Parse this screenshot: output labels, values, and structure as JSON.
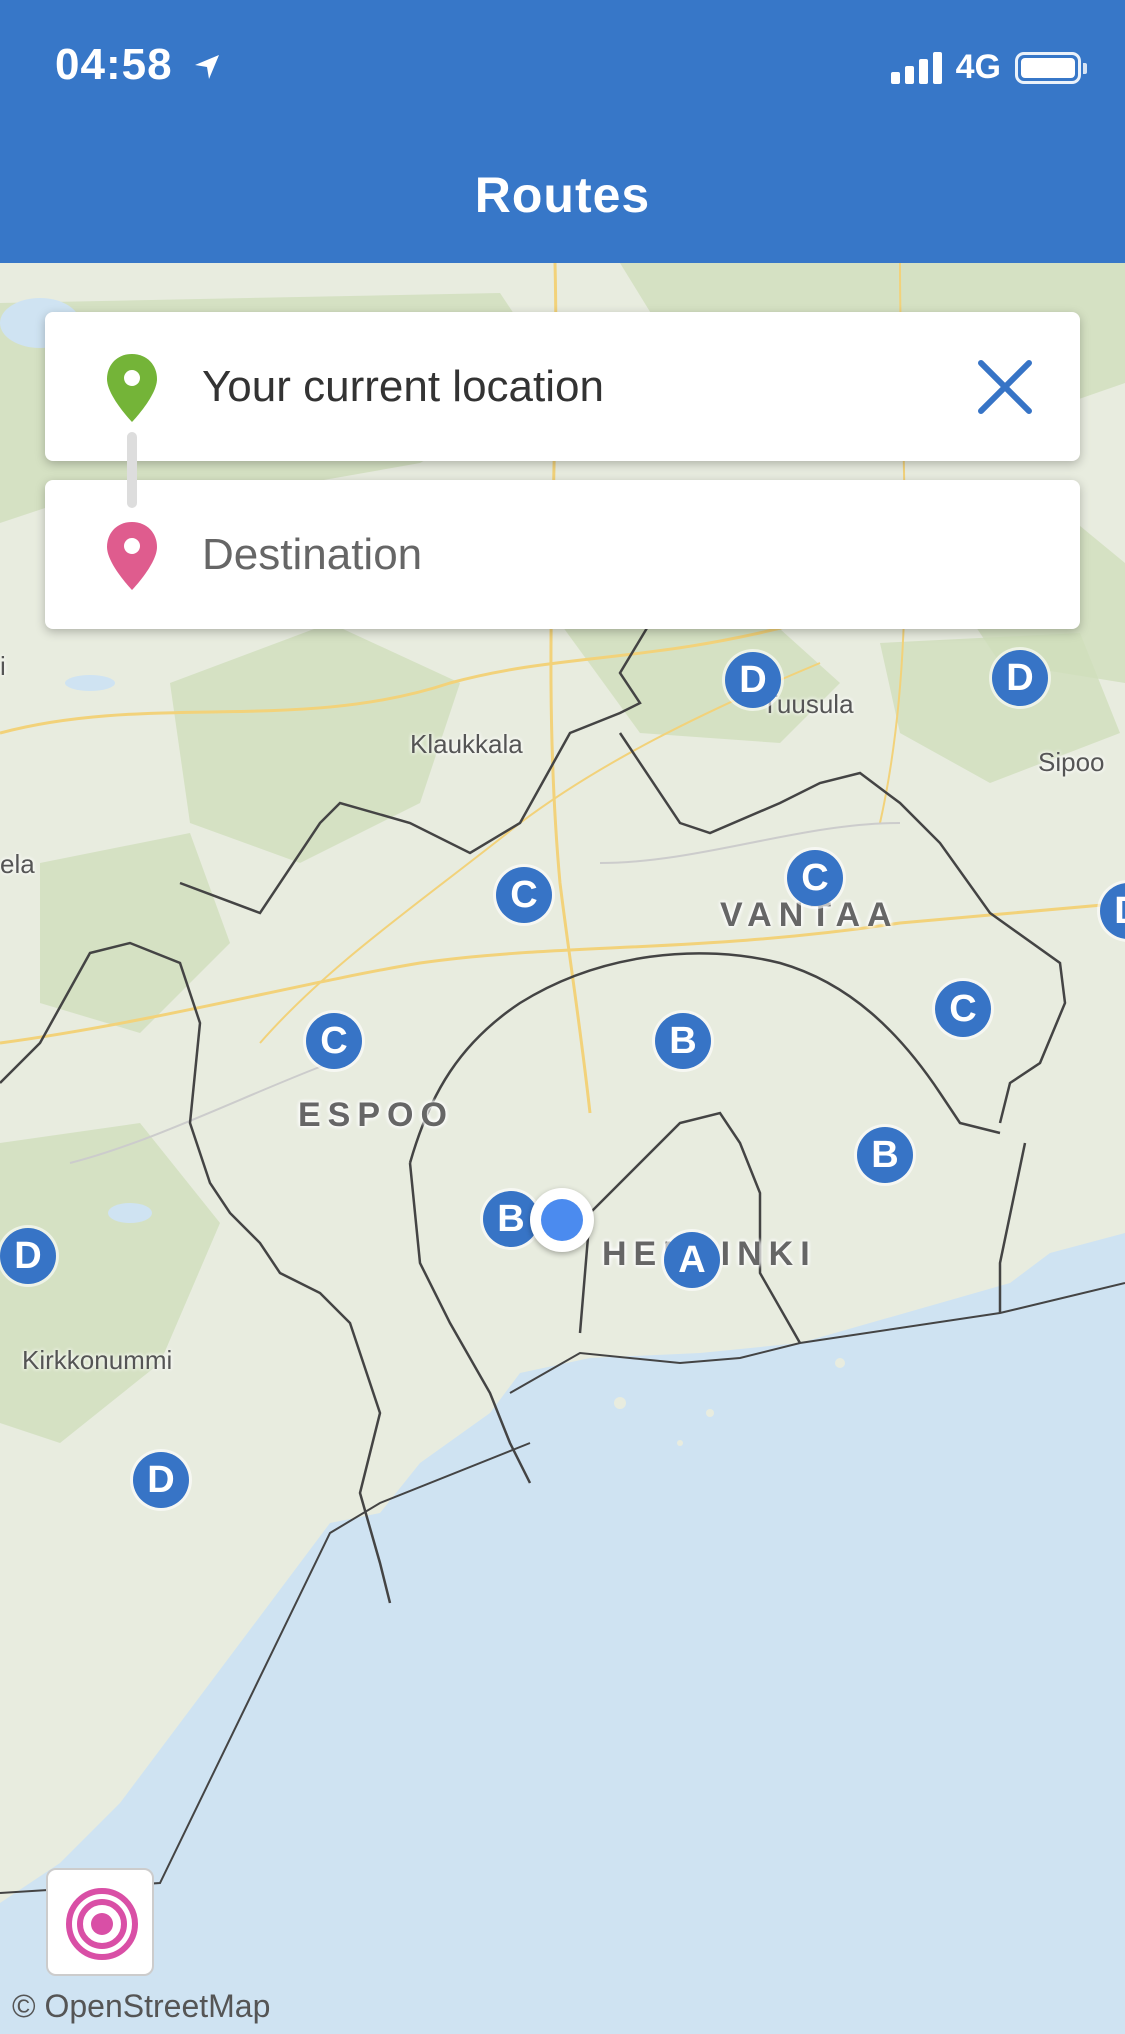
{
  "status_bar": {
    "time": "04:58",
    "network": "4G"
  },
  "header": {
    "title": "Routes"
  },
  "search": {
    "origin_value": "Your current location",
    "destination_placeholder": "Destination"
  },
  "map": {
    "places": [
      "Klaukkala",
      "Tuusula",
      "Sipoo",
      "Kirkkonummi",
      "ela",
      "i"
    ],
    "cities": [
      "VANTAA",
      "ESPOO",
      "HELSINKI"
    ],
    "zones": [
      "D",
      "D",
      "C",
      "C",
      "C",
      "C",
      "B",
      "B",
      "B",
      "A",
      "D",
      "D",
      "D"
    ],
    "attribution": "© OpenStreetMap",
    "colors": {
      "sea": "#cfe3f2",
      "land": "#e9ecdf",
      "forest": "#cddcb8",
      "zone_marker": "#3774c6",
      "user_location": "#4b8bef",
      "header": "#3777c8"
    }
  },
  "icons": {
    "origin": "green-pin-icon",
    "destination": "pink-pin-icon",
    "clear": "close-icon",
    "locate": "locate-target-icon"
  }
}
